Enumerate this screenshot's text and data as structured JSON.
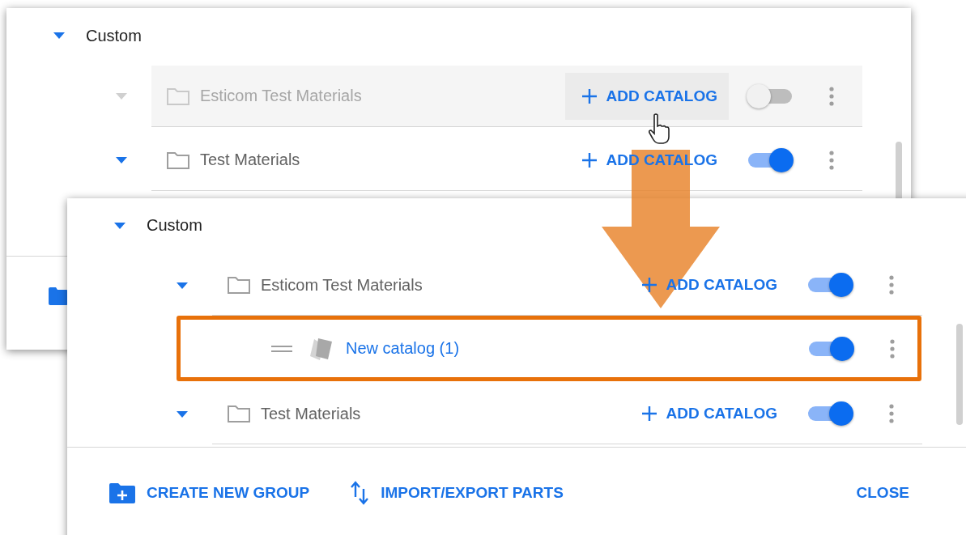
{
  "back_dialog": {
    "tree": {
      "label": "Custom",
      "expanded": true,
      "children": [
        {
          "kind": "folder",
          "label": "Esticom Test Materials",
          "expanded": true,
          "dimmed": true,
          "hovered": true,
          "action": "ADD CATALOG",
          "on": false
        },
        {
          "kind": "folder",
          "label": "Test Materials",
          "expanded": true,
          "dimmed": false,
          "hovered": false,
          "action": "ADD CATALOG",
          "on": true
        }
      ]
    }
  },
  "front_dialog": {
    "tree": {
      "label": "Custom",
      "expanded": true,
      "children": [
        {
          "kind": "folder",
          "label": "Esticom Test Materials",
          "expanded": true,
          "dimmed": false,
          "hovered": false,
          "action": "ADD CATALOG",
          "on": true,
          "children": [
            {
              "kind": "catalog",
              "label": "New catalog (1)",
              "on": true,
              "highlighted": true
            }
          ]
        },
        {
          "kind": "folder",
          "label": "Test Materials",
          "expanded": true,
          "dimmed": false,
          "hovered": false,
          "action": "ADD CATALOG",
          "on": true
        }
      ]
    },
    "footer": [
      {
        "kind": "create",
        "label": "CREATE NEW GROUP"
      },
      {
        "kind": "transfer",
        "label": "IMPORT/EXPORT PARTS"
      },
      {
        "kind": "close",
        "label": "CLOSE"
      }
    ]
  }
}
